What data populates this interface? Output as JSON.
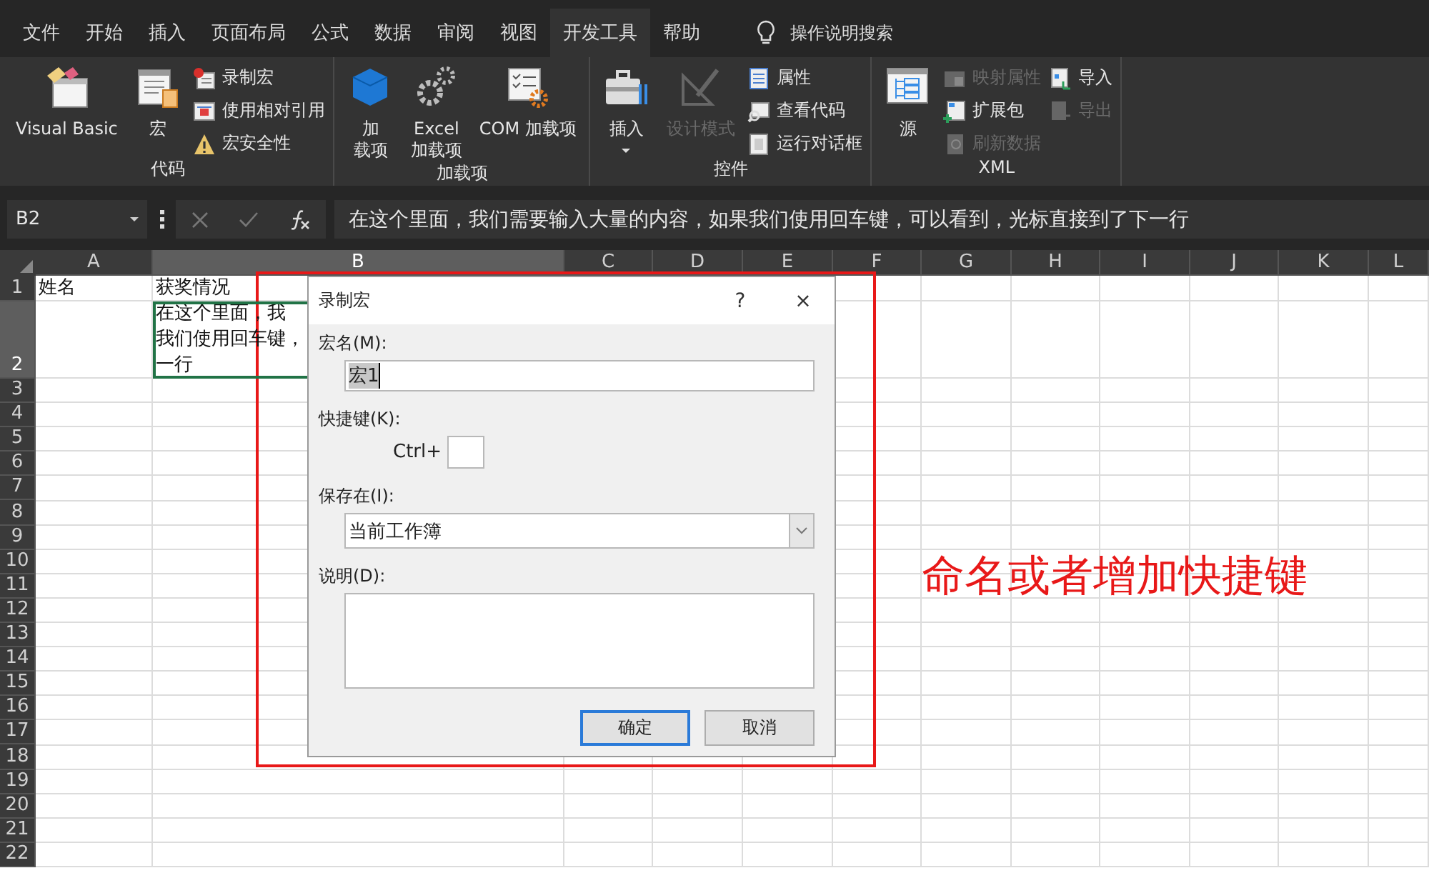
{
  "ribbon_tabs": [
    {
      "label": "文件",
      "selected": false
    },
    {
      "label": "开始",
      "selected": false
    },
    {
      "label": "插入",
      "selected": false
    },
    {
      "label": "页面布局",
      "selected": false
    },
    {
      "label": "公式",
      "selected": false
    },
    {
      "label": "数据",
      "selected": false
    },
    {
      "label": "审阅",
      "selected": false
    },
    {
      "label": "视图",
      "selected": false
    },
    {
      "label": "开发工具",
      "selected": true
    },
    {
      "label": "帮助",
      "selected": false
    }
  ],
  "tell_me": {
    "placeholder": "操作说明搜索"
  },
  "ribbon_groups": [
    {
      "label": "代码",
      "items": [
        {
          "kind": "large",
          "label": "Visual Basic",
          "disabled": false
        },
        {
          "kind": "large",
          "label": "宏",
          "disabled": false
        },
        {
          "kind": "column",
          "items": [
            {
              "label": "录制宏",
              "disabled": false
            },
            {
              "label": "使用相对引用",
              "disabled": false
            },
            {
              "label": "宏安全性",
              "disabled": false
            }
          ]
        }
      ]
    },
    {
      "label": "加载项",
      "items": [
        {
          "kind": "large",
          "lines": [
            "加",
            "载项"
          ],
          "disabled": false
        },
        {
          "kind": "large",
          "lines": [
            "Excel",
            "加载项"
          ],
          "disabled": false
        },
        {
          "kind": "large",
          "label": "COM 加载项",
          "disabled": false
        }
      ]
    },
    {
      "label": "控件",
      "items": [
        {
          "kind": "large",
          "label": "插入",
          "disabled": false,
          "dropdown": true
        },
        {
          "kind": "large",
          "label": "设计模式",
          "disabled": true
        },
        {
          "kind": "column",
          "items": [
            {
              "label": "属性",
              "disabled": false
            },
            {
              "label": "查看代码",
              "disabled": false
            },
            {
              "label": "运行对话框",
              "disabled": false
            }
          ]
        }
      ]
    },
    {
      "label": "XML",
      "items": [
        {
          "kind": "large",
          "label": "源",
          "disabled": false
        },
        {
          "kind": "column",
          "items": [
            {
              "label": "映射属性",
              "disabled": true
            },
            {
              "label": "扩展包",
              "disabled": false
            },
            {
              "label": "刷新数据",
              "disabled": true
            }
          ]
        },
        {
          "kind": "column",
          "items": [
            {
              "label": "导入",
              "disabled": false
            },
            {
              "label": "导出",
              "disabled": true
            }
          ]
        }
      ]
    }
  ],
  "formula_bar": {
    "name_box": "B2",
    "formula": "在这个里面，我们需要输入大量的内容，如果我们使用回车键，可以看到，光标直接到了下一行"
  },
  "sheet": {
    "columns": [
      {
        "label": "A",
        "selected": false
      },
      {
        "label": "B",
        "selected": true
      },
      {
        "label": "C",
        "selected": false
      },
      {
        "label": "D",
        "selected": false
      },
      {
        "label": "E",
        "selected": false
      },
      {
        "label": "F",
        "selected": false
      },
      {
        "label": "G",
        "selected": false
      },
      {
        "label": "H",
        "selected": false
      },
      {
        "label": "I",
        "selected": false
      },
      {
        "label": "J",
        "selected": false
      },
      {
        "label": "K",
        "selected": false
      },
      {
        "label": "L",
        "selected": false
      }
    ],
    "rows": [
      {
        "label": "1",
        "selected": false,
        "cells": [
          "姓名",
          "获奖情况"
        ]
      },
      {
        "label": "2",
        "selected": true,
        "cells": [
          "",
          [
            "在这个里面，我",
            "我们使用回车键，",
            "一行"
          ]
        ]
      },
      {
        "label": "3",
        "selected": false
      },
      {
        "label": "4",
        "selected": false
      },
      {
        "label": "5",
        "selected": false
      },
      {
        "label": "6",
        "selected": false
      },
      {
        "label": "7",
        "selected": false
      },
      {
        "label": "8",
        "selected": false
      },
      {
        "label": "9",
        "selected": false
      },
      {
        "label": "10",
        "selected": false
      },
      {
        "label": "11",
        "selected": false
      },
      {
        "label": "12",
        "selected": false
      },
      {
        "label": "13",
        "selected": false
      },
      {
        "label": "14",
        "selected": false
      },
      {
        "label": "15",
        "selected": false
      },
      {
        "label": "16",
        "selected": false
      },
      {
        "label": "17",
        "selected": false
      },
      {
        "label": "18",
        "selected": false
      },
      {
        "label": "19",
        "selected": false
      },
      {
        "label": "20",
        "selected": false
      },
      {
        "label": "21",
        "selected": false
      },
      {
        "label": "22",
        "selected": false
      }
    ]
  },
  "dialog": {
    "title": "录制宏",
    "help": "?",
    "close": "×",
    "name_label": "宏名(M):",
    "name_value": "宏1",
    "name_value_selected": true,
    "shortcut_label": "快捷键(K):",
    "shortcut_prefix": "Ctrl+",
    "store_label": "保存在(I):",
    "store_value": "当前工作簿",
    "description_label": "说明(D):",
    "buttons": [
      {
        "label": "确定",
        "default": true
      },
      {
        "label": "取消",
        "default": false
      }
    ]
  },
  "annotation": {
    "text": "命名或者增加快捷键"
  }
}
